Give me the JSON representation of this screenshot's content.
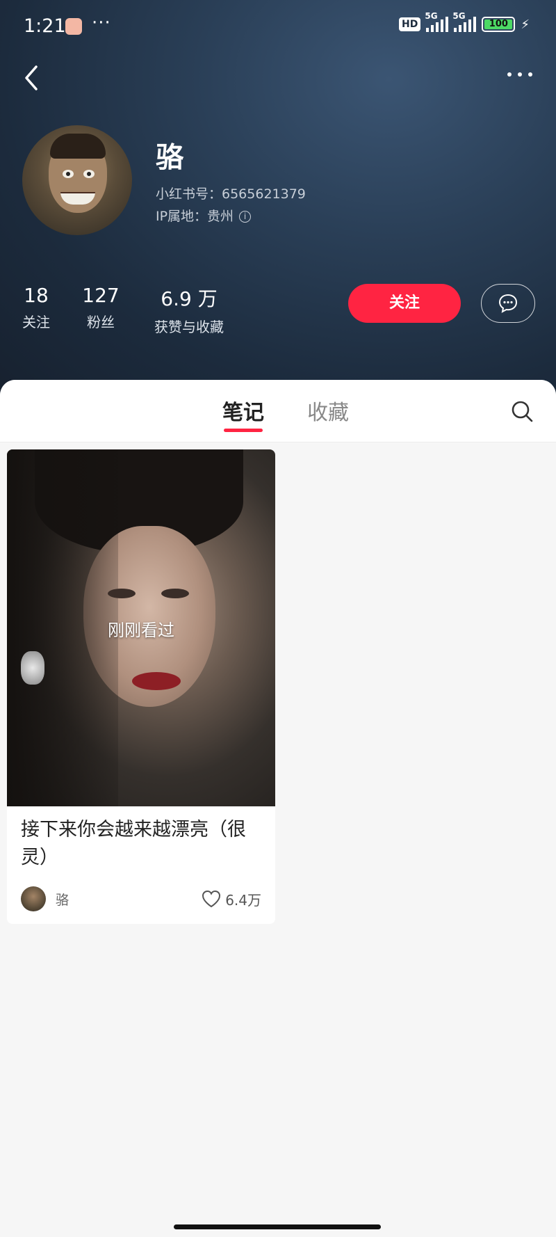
{
  "status_bar": {
    "time": "1:21",
    "more": "···",
    "hd": "HD",
    "network1": "5G",
    "network2": "5G",
    "battery": "100"
  },
  "profile": {
    "name": "骆",
    "id_line": "小红书号：6565621379",
    "ip_line": "IP属地：贵州",
    "info_glyph": "i"
  },
  "stats": [
    {
      "value": "18",
      "label": "关注"
    },
    {
      "value": "127",
      "label": "粉丝"
    },
    {
      "value": "6.9 万",
      "label": "获赞与收藏"
    }
  ],
  "actions": {
    "follow_label": "关注"
  },
  "tabs": {
    "notes": "笔记",
    "favorites": "收藏"
  },
  "notes": [
    {
      "badge": "刚刚看过",
      "title": "接下来你会越来越漂亮（很灵）",
      "author": "骆",
      "likes": "6.4万"
    }
  ],
  "colors": {
    "accent": "#ff2442",
    "header_bg": "#1c2b3d"
  }
}
